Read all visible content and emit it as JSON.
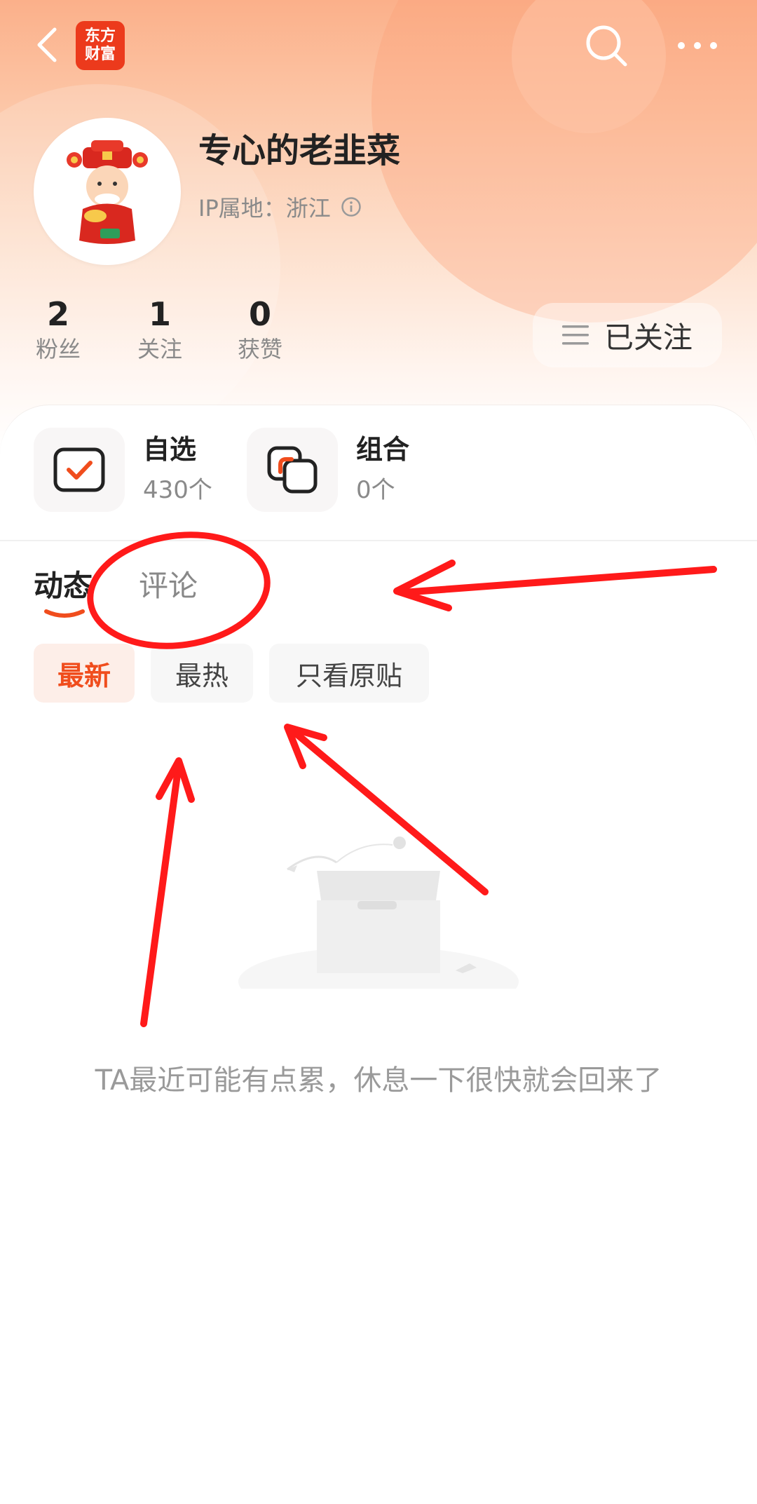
{
  "app": {
    "logo_text_line1": "东方",
    "logo_text_line2": "财富",
    "logo_color": "#ec3a1c"
  },
  "topbar": {
    "back": "back-arrow-icon",
    "search": "search-icon",
    "more": "more-dots-icon"
  },
  "profile": {
    "username": "专心的老韭菜",
    "ip_location": "IP属地：浙江"
  },
  "stats": [
    {
      "value": "2",
      "label": "粉丝"
    },
    {
      "value": "1",
      "label": "关注"
    },
    {
      "value": "0",
      "label": "获赞"
    }
  ],
  "follow_button": {
    "label": "已关注"
  },
  "quick": [
    {
      "title": "自选",
      "count": "430个"
    },
    {
      "title": "组合",
      "count": "0个"
    }
  ],
  "tabs": [
    {
      "label": "动态",
      "active": true
    },
    {
      "label": "评论",
      "active": false
    }
  ],
  "filters": [
    {
      "label": "最新",
      "active": true
    },
    {
      "label": "最热",
      "active": false
    },
    {
      "label": "只看原贴",
      "active": false
    }
  ],
  "empty_state": {
    "message": "TA最近可能有点累，休息一下很快就会回来了"
  },
  "colors": {
    "accent": "#f04d1d",
    "annotation_red": "#ff1a1a",
    "header_peach": "#fbb08a"
  }
}
